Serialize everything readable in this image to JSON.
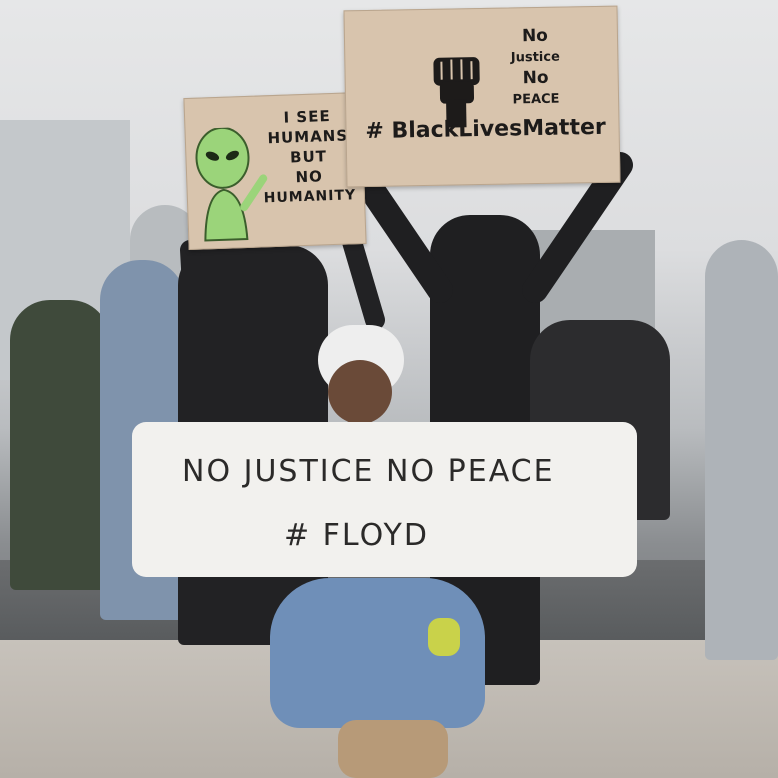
{
  "signs": {
    "left": {
      "text_lines": [
        "I SEE",
        "HUMANS",
        "BUT",
        "NO",
        "HUMANITY"
      ]
    },
    "right": {
      "top_lines": [
        "No",
        "Justice",
        "No",
        "PEACE"
      ],
      "hashtag": "# BlackLivesMatter"
    }
  },
  "shirt": {
    "line1": "NO JUSTICE  NO PEACE",
    "line2": "# FLOYD"
  },
  "colors": {
    "cardboard": "#d8c4ad",
    "alien": "#9bd47a",
    "shirt": "#f2f1ee",
    "jeans": "#6f8fb8"
  },
  "icons": [
    "alien-icon",
    "raised-fist-icon"
  ]
}
